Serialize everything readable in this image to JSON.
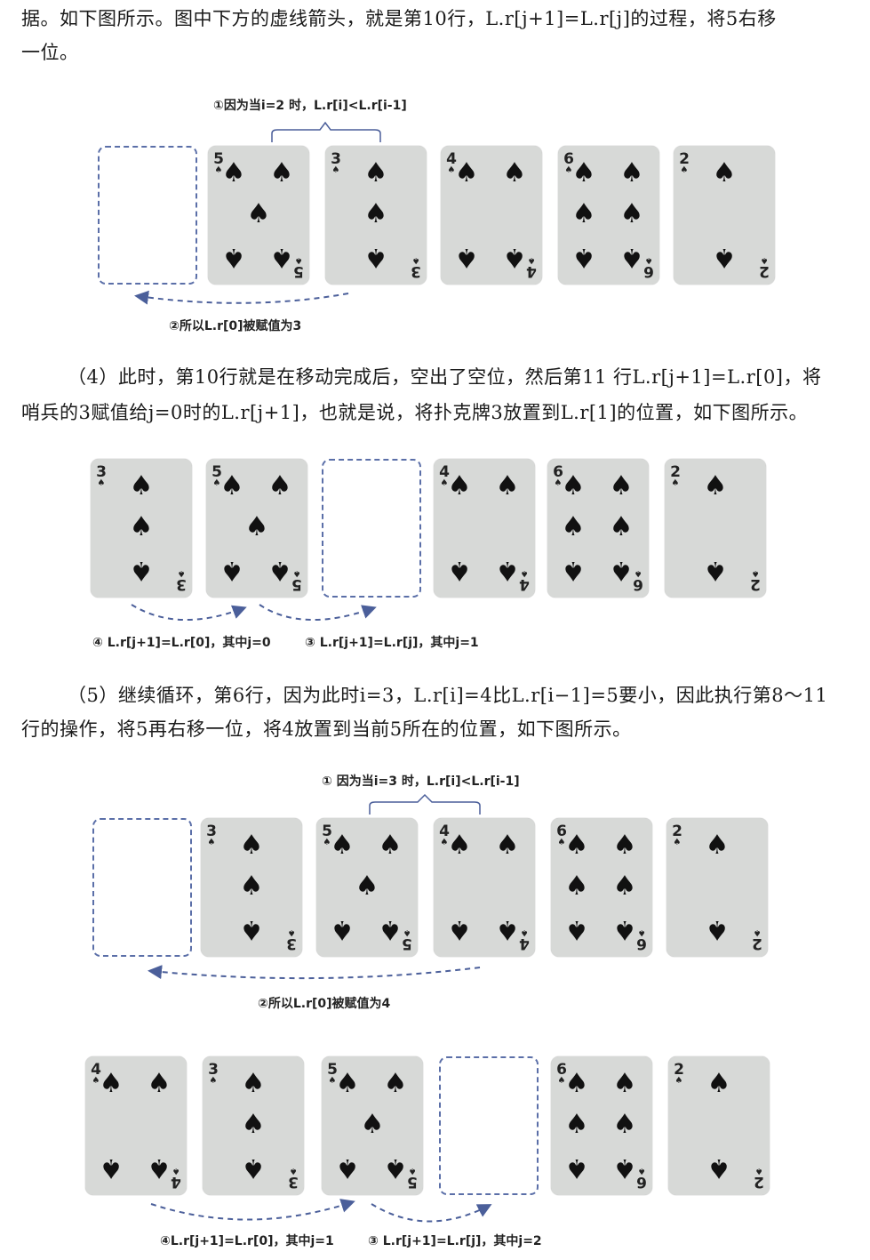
{
  "paragraphs": {
    "p1_line1": "据。如下图所示。图中下方的虚线箭头，就是第10行，L.r[j+1]=L.r[j]的过程，将5右移",
    "p1_line2": "一位。",
    "p2_line1": "（4）此时，第10行就是在移动完成后，空出了空位，然后第11 行L.r[j+1]=L.r[0]，将",
    "p2_line2": "哨兵的3赋值给j=0时的L.r[j+1]，也就是说，将扑克牌3放置到L.r[1]的位置，如下图所示。",
    "p3_line1": "（5）继续循环，第6行，因为此时i=3，L.r[i]=4比L.r[i−1]=5要小，因此执行第8～11",
    "p3_line2": "行的操作，将5再右移一位，将4放置到当前5所在的位置，如下图所示。"
  },
  "figure1": {
    "top_label": "①因为当i=2 时，L.r[i]<L.r[i-1]",
    "bottom_label": "②所以L.r[0]被赋值为3",
    "cards": [
      "",
      "5",
      "3",
      "4",
      "6",
      "2"
    ]
  },
  "figure2": {
    "label_left": "④ L.r[j+1]=L.r[0]，其中j=0",
    "label_right": "③ L.r[j+1]=L.r[j]，其中j=1",
    "cards": [
      "3",
      "5",
      "",
      "4",
      "6",
      "2"
    ]
  },
  "figure3": {
    "top_label": "① 因为当i=3 时，L.r[i]<L.r[i-1]",
    "bottom_label": "②所以L.r[0]被赋值为4",
    "cards": [
      "",
      "3",
      "5",
      "4",
      "6",
      "2"
    ]
  },
  "figure4": {
    "label_left": "④L.r[j+1]=L.r[0]，其中j=1",
    "label_right": "③ L.r[j+1]=L.r[j]，其中j=2",
    "cards": [
      "4",
      "3",
      "5",
      "",
      "6",
      "2"
    ]
  },
  "suit_symbol": "♠",
  "colors": {
    "card_fill": "#d7d9d7",
    "dash": "#5b6fa8"
  }
}
